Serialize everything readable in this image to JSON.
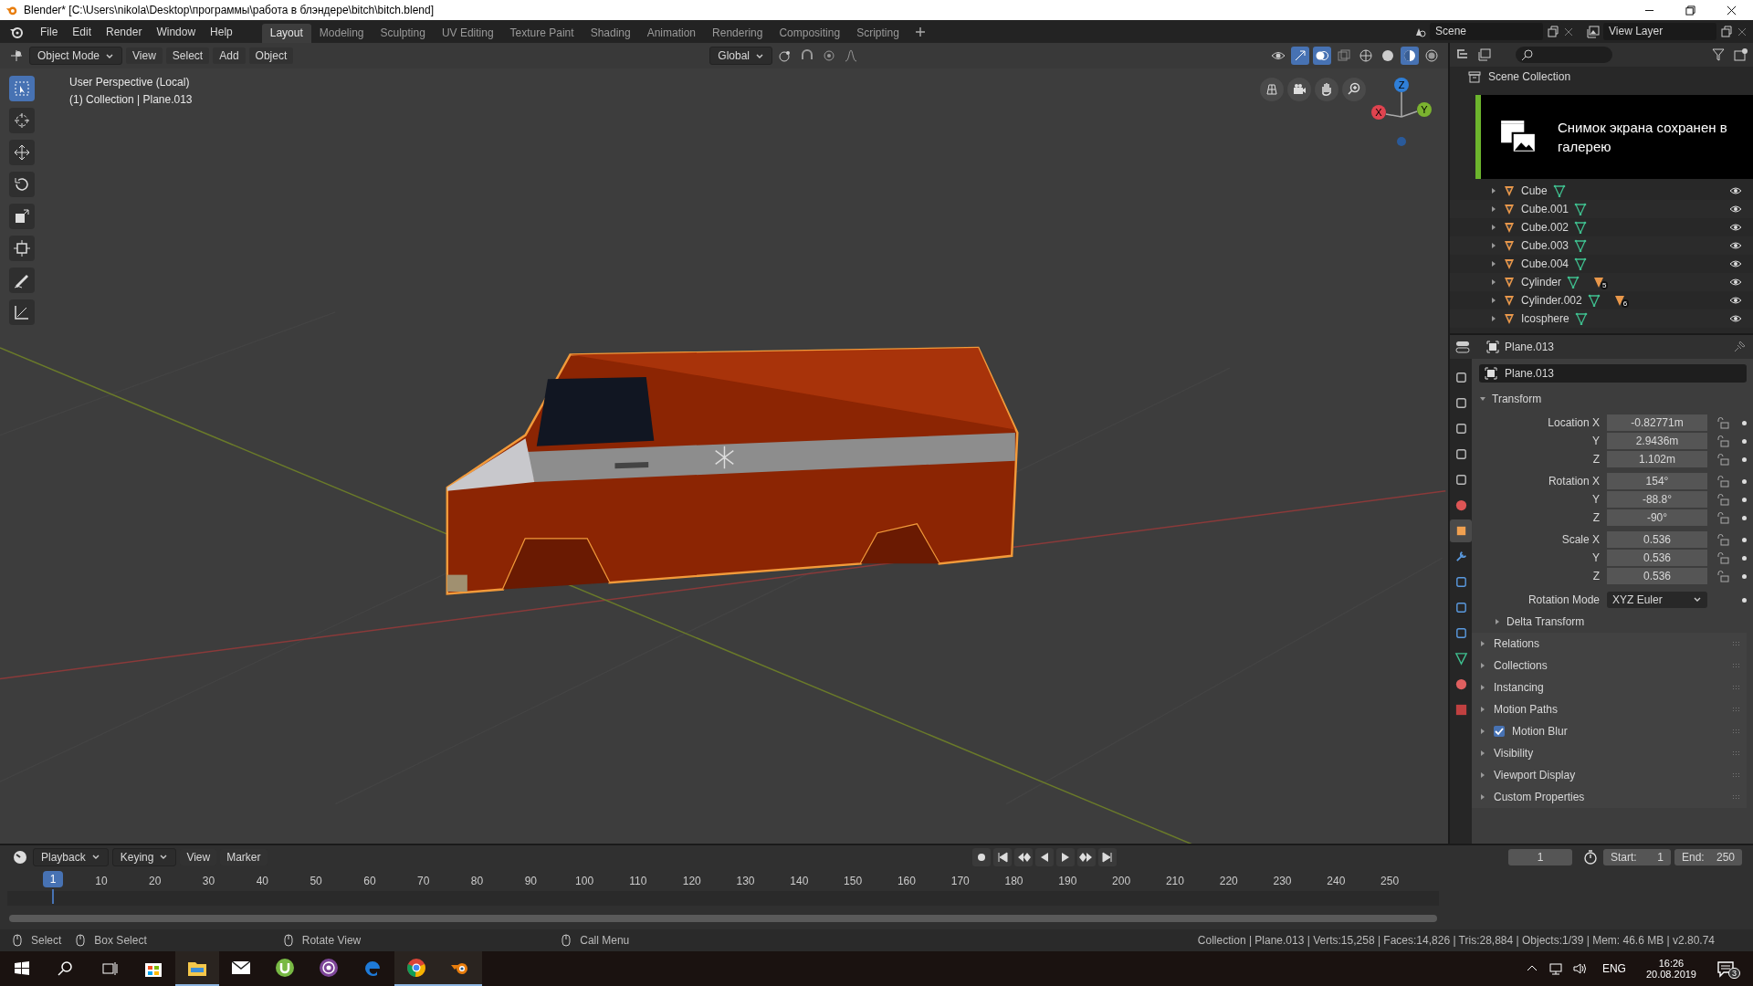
{
  "window": {
    "title": "Blender* [C:\\Users\\nikola\\Desktop\\программы\\работа в блэндере\\bitch\\bitch.blend]"
  },
  "menu": [
    "File",
    "Edit",
    "Render",
    "Window",
    "Help"
  ],
  "workspaces": [
    {
      "label": "Layout",
      "selected": true
    },
    {
      "label": "Modeling",
      "selected": false
    },
    {
      "label": "Sculpting",
      "selected": false
    },
    {
      "label": "UV Editing",
      "selected": false
    },
    {
      "label": "Texture Paint",
      "selected": false
    },
    {
      "label": "Shading",
      "selected": false
    },
    {
      "label": "Animation",
      "selected": false
    },
    {
      "label": "Rendering",
      "selected": false
    },
    {
      "label": "Compositing",
      "selected": false
    },
    {
      "label": "Scripting",
      "selected": false
    }
  ],
  "scene": "Scene",
  "view_layer": "View Layer",
  "viewport": {
    "mode": "Object Mode",
    "menus": [
      "View",
      "Select",
      "Add",
      "Object"
    ],
    "orientation": "Global",
    "info": [
      "User Perspective (Local)",
      "(1) Collection | Plane.013"
    ],
    "gizmo": {
      "x": "X",
      "y": "Y",
      "z": "Z"
    },
    "tools": [
      {
        "kind": "select",
        "selected": true
      },
      {
        "kind": "cursor",
        "selected": false
      },
      {
        "kind": "move",
        "selected": false
      },
      {
        "kind": "rotate",
        "selected": false
      },
      {
        "kind": "scale",
        "selected": false
      },
      {
        "kind": "transform",
        "selected": false
      },
      {
        "kind": "annotate",
        "selected": false
      },
      {
        "kind": "measure",
        "selected": false
      }
    ]
  },
  "outliner": {
    "root": "Scene Collection",
    "items": [
      {
        "name": "Cube",
        "visible": true
      },
      {
        "name": "Cube.001",
        "visible": true
      },
      {
        "name": "Cube.002",
        "visible": true
      },
      {
        "name": "Cube.003",
        "visible": true
      },
      {
        "name": "Cube.004",
        "visible": true
      },
      {
        "name": "Cylinder",
        "visible": true,
        "badge": "5"
      },
      {
        "name": "Cylinder.002",
        "visible": true,
        "badge": "6"
      },
      {
        "name": "Icosphere",
        "visible": true
      }
    ]
  },
  "notification": {
    "text": "Снимок экрана сохранен в галерею"
  },
  "properties": {
    "header": "Plane.013",
    "object_name": "Plane.013",
    "tabs": [
      {
        "kind": "tool",
        "selected": false
      },
      {
        "kind": "render",
        "selected": false
      },
      {
        "kind": "output",
        "selected": false
      },
      {
        "kind": "view_layer",
        "selected": false
      },
      {
        "kind": "scene",
        "selected": false
      },
      {
        "kind": "world",
        "selected": false
      },
      {
        "kind": "object",
        "selected": true
      },
      {
        "kind": "modifiers",
        "selected": false
      },
      {
        "kind": "particles",
        "selected": false
      },
      {
        "kind": "physics",
        "selected": false
      },
      {
        "kind": "constraints",
        "selected": false
      },
      {
        "kind": "data",
        "selected": false
      },
      {
        "kind": "material",
        "selected": false
      },
      {
        "kind": "texture",
        "selected": false
      }
    ],
    "transform": {
      "title": "Transform",
      "expanded": true,
      "groups": [
        [
          {
            "label": "Location X",
            "value": "-0.82771m"
          },
          {
            "label": "Y",
            "value": "2.9436m"
          },
          {
            "label": "Z",
            "value": "1.102m"
          }
        ],
        [
          {
            "label": "Rotation X",
            "value": "154°"
          },
          {
            "label": "Y",
            "value": "-88.8°"
          },
          {
            "label": "Z",
            "value": "-90°"
          }
        ],
        [
          {
            "label": "Scale X",
            "value": "0.536"
          },
          {
            "label": "Y",
            "value": "0.536"
          },
          {
            "label": "Z",
            "value": "0.536"
          }
        ]
      ],
      "rotation_mode": {
        "label": "Rotation Mode",
        "value": "XYZ Euler"
      },
      "subpanel": {
        "title": "Delta Transform",
        "expanded": false
      }
    },
    "panels": [
      {
        "title": "Relations",
        "expanded": false
      },
      {
        "title": "Collections",
        "expanded": false
      },
      {
        "title": "Instancing",
        "expanded": false
      },
      {
        "title": "Motion Paths",
        "expanded": false
      },
      {
        "title": "Motion Blur",
        "expanded": false,
        "checked": true
      },
      {
        "title": "Visibility",
        "expanded": false
      },
      {
        "title": "Viewport Display",
        "expanded": false
      },
      {
        "title": "Custom Properties",
        "expanded": false
      }
    ]
  },
  "timeline": {
    "menus": [
      "Playback",
      "Keying",
      "View",
      "Marker"
    ],
    "current_frame": "1",
    "start_label": "Start:",
    "start": "1",
    "end_label": "End:",
    "end": "250",
    "playhead": "1",
    "ticks": [
      "10",
      "20",
      "30",
      "40",
      "50",
      "60",
      "70",
      "80",
      "90",
      "100",
      "110",
      "120",
      "130",
      "140",
      "150",
      "160",
      "170",
      "180",
      "190",
      "200",
      "210",
      "220",
      "230",
      "240",
      "250"
    ]
  },
  "status_bar": {
    "hints": [
      "Select",
      "Box Select",
      "Rotate View",
      "Call Menu"
    ],
    "stats": "Collection | Plane.013 | Verts:15,258 | Faces:14,826 | Tris:28,884 | Objects:1/39 | Mem: 46.6 MB | v2.80.74"
  },
  "taskbar": {
    "apps": [
      {
        "kind": "store",
        "running": false
      },
      {
        "kind": "explorer",
        "running": true
      },
      {
        "kind": "mail",
        "running": false
      },
      {
        "kind": "torrent",
        "running": false
      },
      {
        "kind": "tor",
        "running": false
      },
      {
        "kind": "edge",
        "running": false
      },
      {
        "kind": "chrome",
        "running": true
      },
      {
        "kind": "blender",
        "running": true
      }
    ],
    "language": "ENG",
    "time": "16:26",
    "date": "20.08.2019",
    "notifications": "3"
  }
}
